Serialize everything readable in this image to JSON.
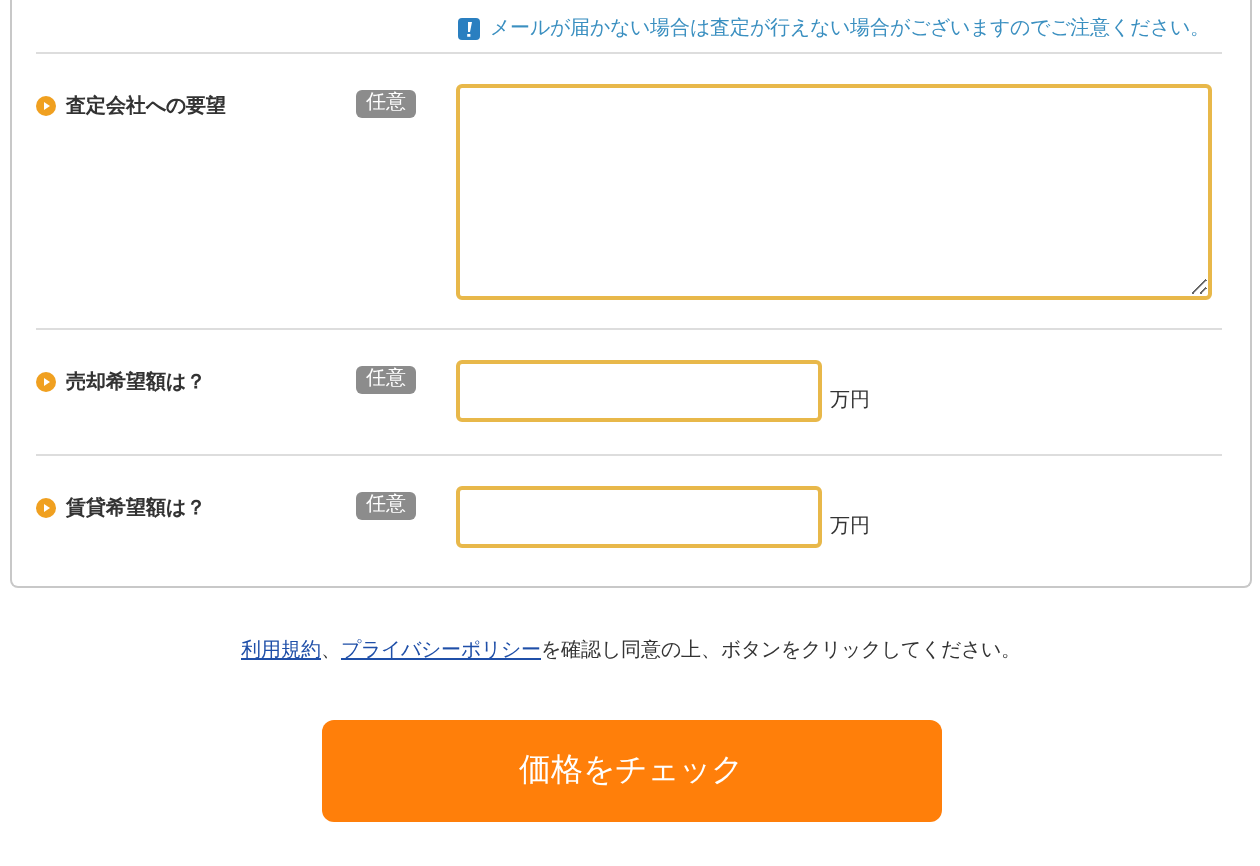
{
  "notice": {
    "text": "メールが届かない場合は査定が行えない場合がございますのでご注意ください。"
  },
  "fields": [
    {
      "kind": "textarea",
      "label": "査定会社への要望",
      "badge": "任意"
    },
    {
      "kind": "amount",
      "label": "売却希望額は？",
      "badge": "任意",
      "unit": "万円"
    },
    {
      "kind": "amount",
      "label": "賃貸希望額は？",
      "badge": "任意",
      "unit": "万円"
    }
  ],
  "agreement": {
    "links": [
      "利用規約",
      "プライバシーポリシー"
    ],
    "separator": "、",
    "text": "を確認し同意の上、ボタンをクリックしてください。"
  },
  "submit_button": "価格をチェック"
}
